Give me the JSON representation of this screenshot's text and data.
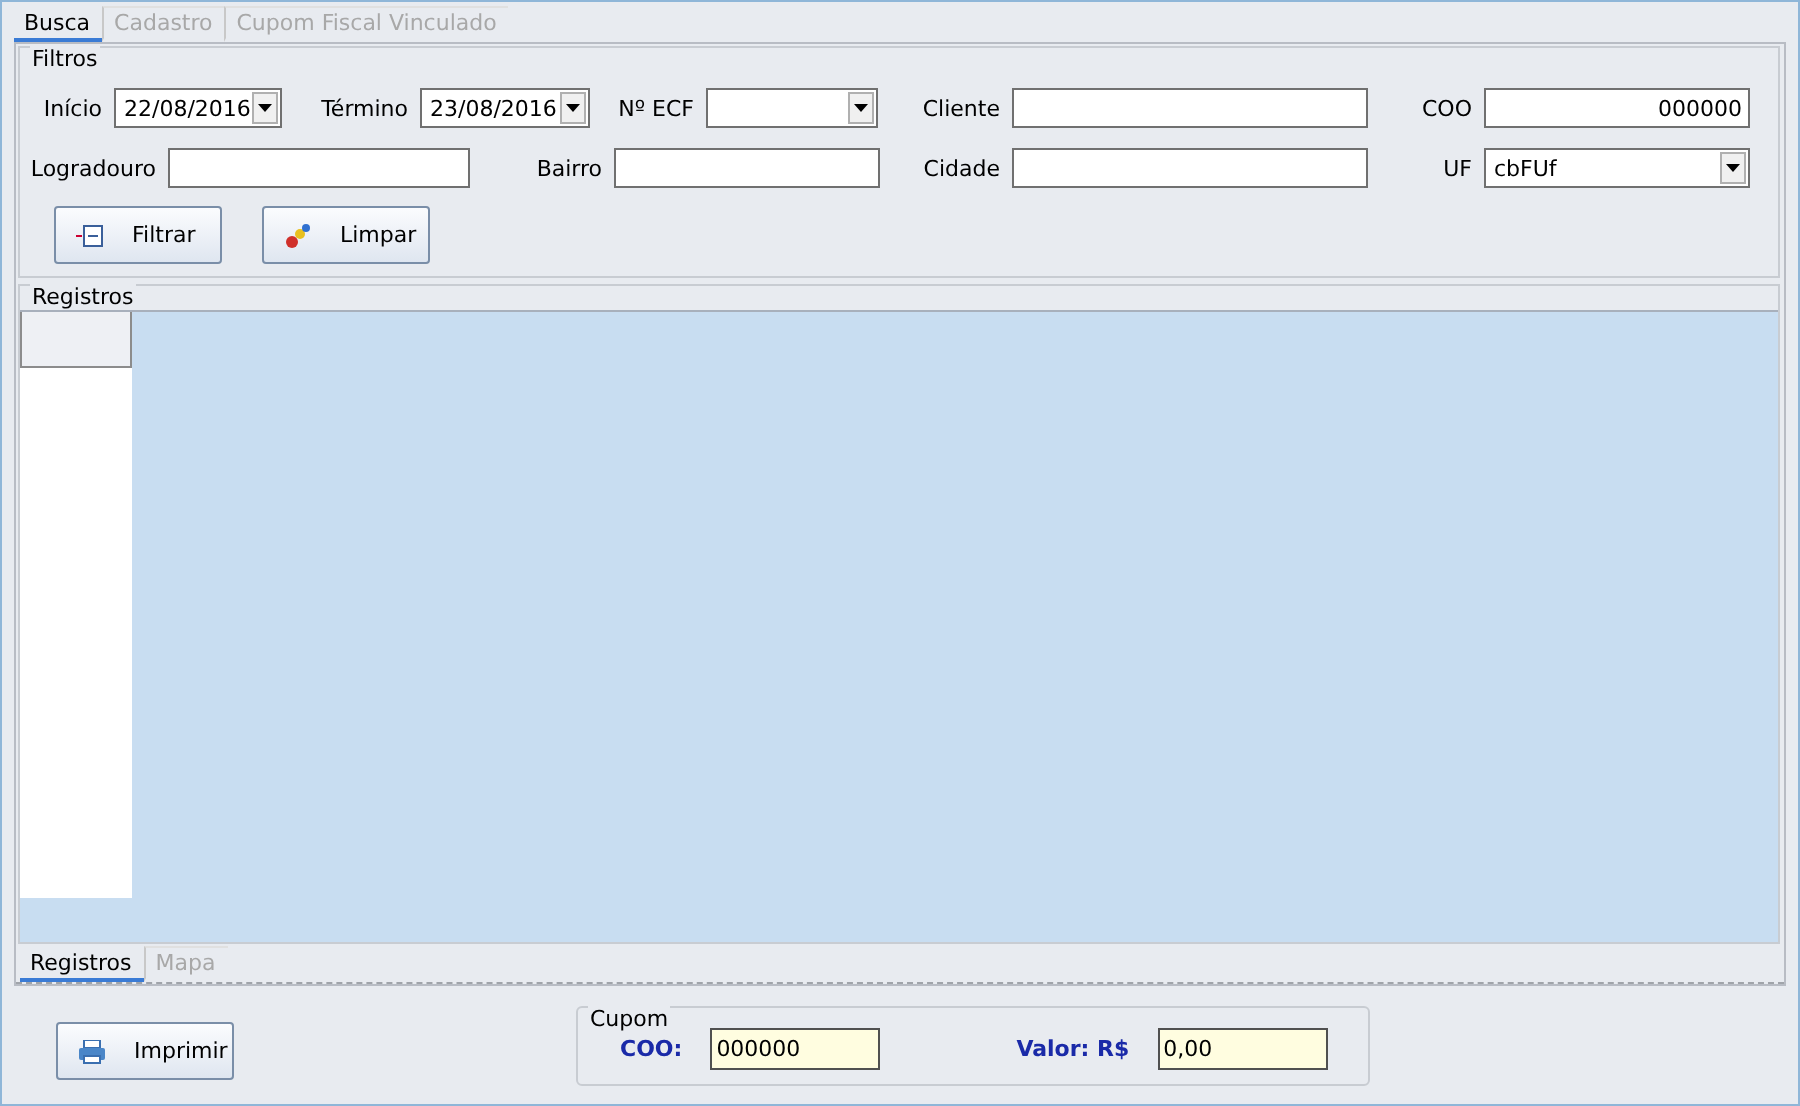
{
  "tabs": [
    {
      "label": "Busca",
      "selected": true,
      "disabled": false
    },
    {
      "label": "Cadastro",
      "selected": false,
      "disabled": true
    },
    {
      "label": "Cupom Fiscal Vinculado",
      "selected": false,
      "disabled": true
    }
  ],
  "filters": {
    "title": "Filtros",
    "fields": [
      {
        "label": "Início",
        "kind": "date",
        "value": "22/08/2016",
        "new_line": false
      },
      {
        "label": "Término",
        "kind": "date",
        "value": "23/08/2016",
        "new_line": false
      },
      {
        "label": "Nº ECF",
        "kind": "combo",
        "new_line": false
      },
      {
        "label": "Cliente",
        "kind": "text",
        "new_line": false
      },
      {
        "label": "COO",
        "kind": "number",
        "value": "000000",
        "new_line": false
      },
      {
        "label": "Logradouro",
        "kind": "text",
        "new_line": true
      },
      {
        "label": "Bairro",
        "kind": "text",
        "new_line": false
      },
      {
        "label": "Cidade",
        "kind": "text",
        "new_line": false
      },
      {
        "label": "UF",
        "kind": "combo",
        "value": "cbFUf",
        "new_line": false
      }
    ],
    "buttons": [
      {
        "label": "Filtrar"
      },
      {
        "label": "Limpar"
      }
    ]
  },
  "records": {
    "title": "Registros"
  },
  "bottom_tabs": [
    {
      "label": "Registros",
      "selected": true,
      "disabled": false
    },
    {
      "label": "Mapa",
      "selected": false,
      "disabled": true
    }
  ],
  "print_button": {
    "label": "Imprimir"
  },
  "cupom": {
    "title": "Cupom",
    "fields": [
      {
        "label": "COO:",
        "value": "000000"
      },
      {
        "label": "Valor: R$",
        "value": "0,00"
      }
    ]
  }
}
